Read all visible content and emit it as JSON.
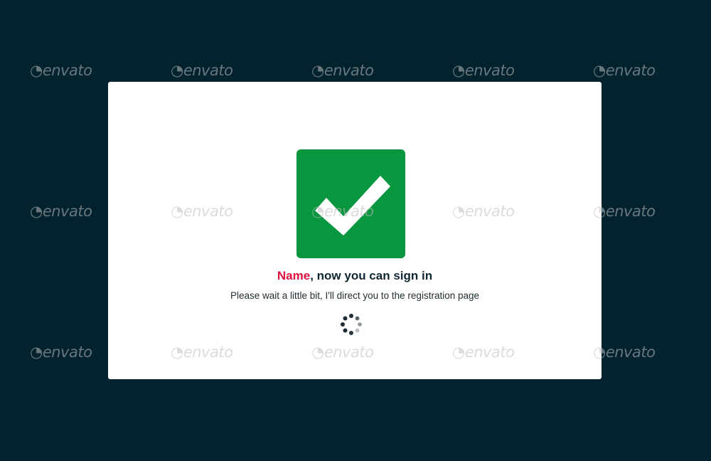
{
  "dialog": {
    "headline_name": "Name",
    "headline_rest": ", now you can sign in",
    "subline": "Please wait a little bit, I'll direct you to the registration page"
  },
  "icons": {
    "success": "checkmark-icon",
    "loading": "loading-spinner-icon"
  },
  "watermark": {
    "text": "envato"
  },
  "colors": {
    "background": "#02222e",
    "dialog": "#ffffff",
    "success": "#08963f",
    "accent": "#e0103e",
    "text": "#102733"
  }
}
